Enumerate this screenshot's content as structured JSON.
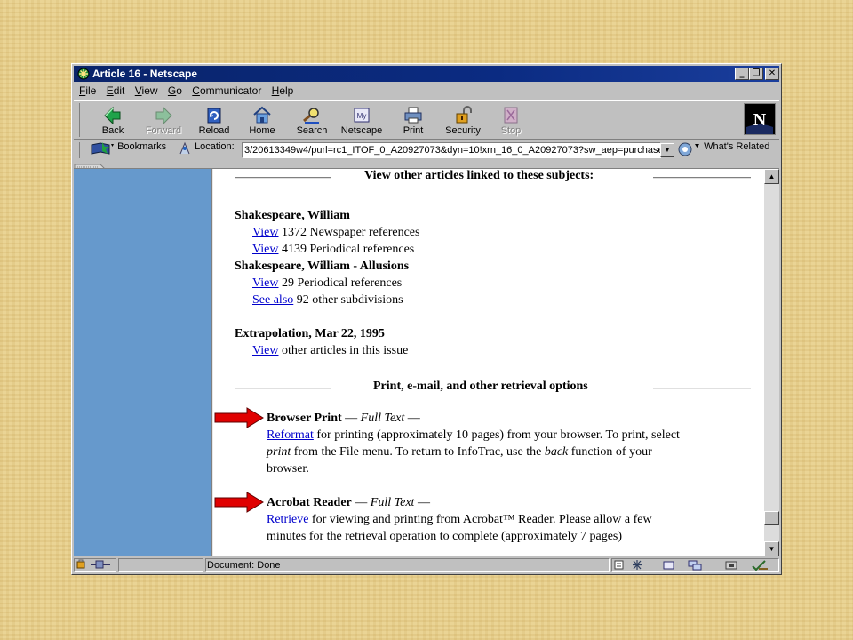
{
  "window": {
    "title": "Article 16 - Netscape"
  },
  "menubar": {
    "items": [
      {
        "label": "File",
        "u": "F",
        "rest": "ile"
      },
      {
        "label": "Edit",
        "u": "E",
        "rest": "dit"
      },
      {
        "label": "View",
        "u": "V",
        "rest": "iew"
      },
      {
        "label": "Go",
        "u": "G",
        "rest": "o"
      },
      {
        "label": "Communicator",
        "u": "C",
        "rest": "ommunicator"
      },
      {
        "label": "Help",
        "u": "H",
        "rest": "elp"
      }
    ]
  },
  "toolbar": {
    "back": "Back",
    "forward": "Forward",
    "reload": "Reload",
    "home": "Home",
    "search": "Search",
    "netscape": "Netscape",
    "print": "Print",
    "security": "Security",
    "stop": "Stop"
  },
  "location": {
    "bookmarks": "Bookmarks",
    "label": "Location:",
    "url": "3/20613349w4/purl=rc1_ITOF_0_A20927073&dyn=10!xrn_16_0_A20927073?sw_aep=purchase",
    "whats_related": "What's Related"
  },
  "content": {
    "section1_header": "View other articles linked to these subjects:",
    "subject1": "Shakespeare, William",
    "s1_view1_link": "View",
    "s1_view1_text": " 1372 Newspaper references",
    "s1_view2_link": "View",
    "s1_view2_text": " 4139 Periodical references",
    "subject2": "Shakespeare, William - Allusions",
    "s2_view1_link": "View",
    "s2_view1_text": " 29 Periodical references",
    "s2_see_link": "See also",
    "s2_see_text": " 92 other subdivisions",
    "subject3": "Extrapolation, Mar 22, 1995",
    "s3_view_link": "View",
    "s3_view_text": " other articles in this issue",
    "section2_header": "Print, e-mail, and other retrieval options",
    "bp_title": "Browser Print",
    "bp_dash1": " — ",
    "bp_full": "Full Text",
    "bp_dash2": " —",
    "bp_link": "Reformat",
    "bp_line1": " for printing (approximately 10 pages) from your browser. To print, select",
    "bp_line2a": "print",
    "bp_line2b": " from the File menu. To return to InfoTrac, use the ",
    "bp_line2c": "back",
    "bp_line2d": " function of your",
    "bp_line3": "browser.",
    "ar_title": "Acrobat Reader",
    "ar_dash1": " — ",
    "ar_full": "Full Text",
    "ar_dash2": " —",
    "ar_link": "Retrieve",
    "ar_line1": " for viewing and printing from Acrobat™ Reader. Please allow a few",
    "ar_line2": "minutes for the retrieval operation to complete (approximately 7 pages)"
  },
  "status": {
    "text": "Document: Done"
  },
  "colors": {
    "title_bar": "#0a246a",
    "left_pane": "#6699cc",
    "link": "#0000cc",
    "arrow": "#e00000",
    "desktop": "#e7cf8c"
  },
  "icons": [
    "netscape-app-icon",
    "back-icon",
    "forward-icon",
    "reload-icon",
    "home-icon",
    "search-icon",
    "netscape-icon",
    "print-icon",
    "security-icon",
    "stop-icon",
    "bookmarks-icon",
    "location-icon",
    "whats-related-icon",
    "netscape-logo",
    "red-arrow-icon"
  ]
}
